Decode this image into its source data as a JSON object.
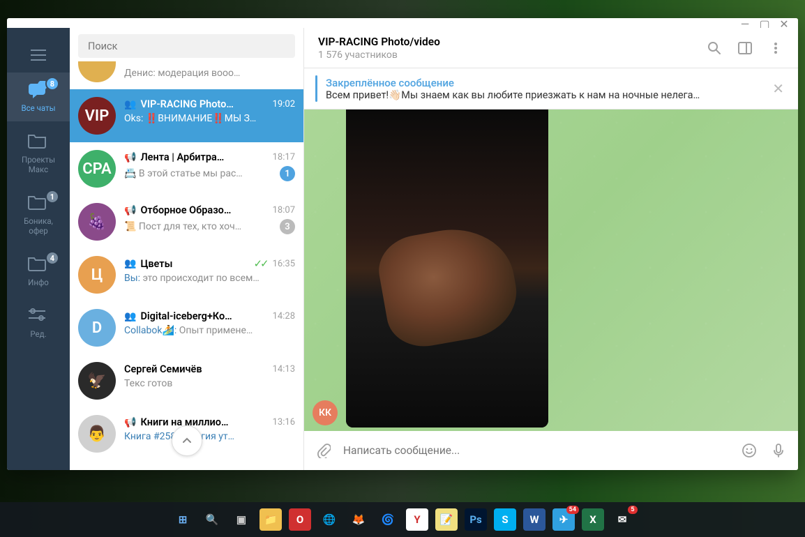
{
  "window": {
    "minimize": "—",
    "maximize": "▢",
    "close": "✕"
  },
  "folders": {
    "all_chats_label": "Все чаты",
    "all_chats_badge": "8",
    "projects_label": "Проекты\nМакс",
    "bonika_label": "Боника,\nофер",
    "bonika_badge": "1",
    "info_label": "Инфо",
    "info_badge": "4",
    "edit_label": "Ред."
  },
  "search": {
    "placeholder": "Поиск"
  },
  "chats": [
    {
      "name": "",
      "time": "",
      "msg": "Денис: модерация вооо…",
      "type": "cut"
    },
    {
      "name": "VIP-RACING Photo…",
      "time": "19:02",
      "sender": "Oks:",
      "msg": "‼️ВНИМАНИЕ‼️МЫ З…",
      "av": "VIP",
      "avbg": "#7a2020",
      "sel": true,
      "group": true
    },
    {
      "name": "Лента | Арбитра…",
      "time": "18:17",
      "msg": "📇 В этой статье мы рас…",
      "av": "CPA",
      "avbg": "#3eb06a",
      "count": "1",
      "countblue": true,
      "channel": true
    },
    {
      "name": "Отборное Образо…",
      "time": "18:07",
      "msg": "📜 Пост для тех, кто хоч…",
      "av": "🍇",
      "avbg": "#8a4a8a",
      "count": "3",
      "channel": true
    },
    {
      "name": "Цветы",
      "time": "16:35",
      "sender": "Вы:",
      "msg": "это происходит по всем…",
      "av": "Ц",
      "avbg": "#e8a050",
      "group": true,
      "read": true
    },
    {
      "name": "Digital-iceberg+Ко…",
      "time": "14:28",
      "sender": "Collabok🏄:",
      "msg": "Опыт примене…",
      "av": "D",
      "avbg": "#6ab0e0",
      "group": true,
      "senderblue": true
    },
    {
      "name": "Сергей Семичёв",
      "time": "14:13",
      "msg": "Текс готов",
      "av": "🦅",
      "avbg": "#2a2a2a"
    },
    {
      "name": "Книги на миллио…",
      "time": "13:16",
      "msg": "Книга #258 – Магия ут…",
      "av": "👨",
      "avbg": "#d0d0d0",
      "channel": true,
      "msgblue": true
    }
  ],
  "header": {
    "title": "VIP-RACING Photo/video",
    "subtitle": "1 576 участников"
  },
  "pinned": {
    "title": "Закреплённое сообщение",
    "msg": "Всем привет!👋🏻Мы знаем как вы любите приезжать к нам на ночные нелега…"
  },
  "message": {
    "avatar": "КК"
  },
  "compose": {
    "placeholder": "Написать сообщение..."
  },
  "taskbar": {
    "items": [
      {
        "name": "start",
        "bg": "transparent",
        "txt": "⊞",
        "col": "#6aaef0"
      },
      {
        "name": "search",
        "bg": "transparent",
        "txt": "🔍",
        "col": "#eee"
      },
      {
        "name": "taskview",
        "bg": "transparent",
        "txt": "▣",
        "col": "#ccc"
      },
      {
        "name": "explorer",
        "bg": "#f0c050",
        "txt": "📁"
      },
      {
        "name": "opera",
        "bg": "#d03030",
        "txt": "O",
        "col": "#fff"
      },
      {
        "name": "chrome",
        "bg": "transparent",
        "txt": "🌐"
      },
      {
        "name": "firefox",
        "bg": "transparent",
        "txt": "🦊"
      },
      {
        "name": "edge",
        "bg": "transparent",
        "txt": "🌀"
      },
      {
        "name": "yandex",
        "bg": "#fff",
        "txt": "Y",
        "col": "#d03030"
      },
      {
        "name": "notepad",
        "bg": "#f0e080",
        "txt": "📝"
      },
      {
        "name": "ps",
        "bg": "#001530",
        "txt": "Ps",
        "col": "#5ab0f0"
      },
      {
        "name": "skype",
        "bg": "#00aff0",
        "txt": "S",
        "col": "#fff"
      },
      {
        "name": "word",
        "bg": "#2b579a",
        "txt": "W",
        "col": "#fff"
      },
      {
        "name": "telegram",
        "bg": "#30a0e0",
        "txt": "✈",
        "col": "#fff",
        "badge": "54"
      },
      {
        "name": "excel",
        "bg": "#217346",
        "txt": "X",
        "col": "#fff"
      },
      {
        "name": "mail",
        "bg": "transparent",
        "txt": "✉",
        "col": "#fff",
        "badge": "5"
      }
    ]
  }
}
